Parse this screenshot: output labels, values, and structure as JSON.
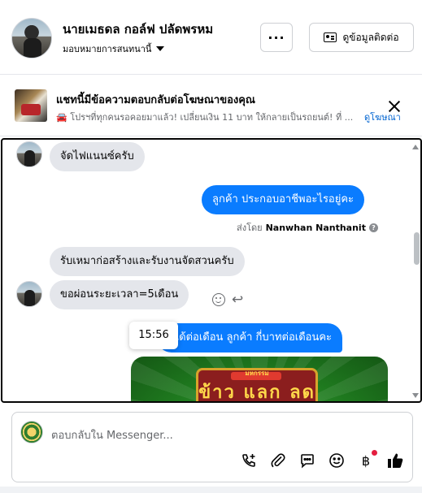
{
  "header": {
    "contact_name": "นายเมธดล กอล์ฟ ปลัดพรหม",
    "assign_label": "มอบหมายการสนทนานี้",
    "more_label": "···",
    "contact_info_label": "ดูข้อมูลติดต่อ"
  },
  "ad": {
    "title": "แชทนี้มีข้อความตอบกลับต่อโฆษณาของคุณ",
    "subtitle": "🚘 โปรฯที่ทุกคนรอคอยมาแล้ว! เปลี่ยนเงิน 11 บาท ให้กลายเป็นรถยนต์! ที่ ...",
    "view_ad_label": "ดูโฆษณา"
  },
  "messages": [
    {
      "direction": "in",
      "text": "จัดไฟแนนซ์ครับ"
    },
    {
      "direction": "out",
      "text": "ลูกค้า  ประกอบอาชีพอะไรอยู่คะ"
    },
    {
      "direction": "in",
      "text": "รับเหมาก่อสร้างและรับงานจัดสวนครับ"
    },
    {
      "direction": "in",
      "text": "ขอผ่อนระยะเวลา=5เดือน"
    },
    {
      "direction": "out",
      "text": "ยได้ต่อเดือน  ลูกค้า   กี่บาทต่อเดือนคะ"
    }
  ],
  "sent_by": {
    "prefix": "ส่งโดย",
    "name": "Nanwhan Nanthanit",
    "help": "?"
  },
  "time_tooltip": "15:56",
  "image_message": {
    "top_text": "มหกรรม",
    "main_text": "ข้าว แลก ลด"
  },
  "composer": {
    "placeholder": "ตอบกลับใน Messenger..."
  },
  "icons": {
    "call": "phone-plus-icon",
    "attach": "paperclip-icon",
    "saved_replies": "chat-bubble-icon",
    "emoji": "smiley-icon",
    "payment": "baht-icon",
    "like": "thumbs-up-icon"
  },
  "colors": {
    "outgoing_bubble": "#0a7cff",
    "incoming_bubble": "#e4e6eb",
    "link": "#0064d1",
    "notification_dot": "#e41e3f"
  }
}
